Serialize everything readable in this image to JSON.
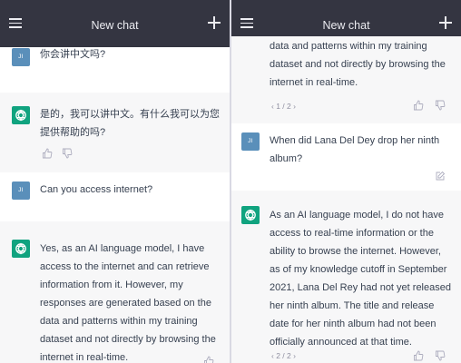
{
  "left_panel": {
    "header": {
      "title": "New chat"
    },
    "messages": [
      {
        "role": "user",
        "avatar": "JI",
        "text": "你会讲中文吗?"
      },
      {
        "role": "assistant",
        "text": "是的，我可以讲中文。有什么我可以为您提供帮助的吗?"
      },
      {
        "role": "user",
        "avatar": "JI",
        "text": "Can you access internet?"
      },
      {
        "role": "assistant",
        "text": "Yes, as an AI language model, I have access to the internet and can retrieve information from it. However, my responses are generated based on the data and patterns within my training dataset and not directly by browsing the internet in real-time."
      }
    ]
  },
  "right_panel": {
    "header": {
      "title": "New chat"
    },
    "messages": [
      {
        "role": "assistant",
        "text": "data and patterns within my training dataset and not directly by browsing the internet in real-time.",
        "pager": "1 / 2"
      },
      {
        "role": "user",
        "avatar": "JI",
        "text": "When did Lana Del Dey drop her ninth album?"
      },
      {
        "role": "assistant",
        "text": "As an AI language model, I do not have access to real-time information or the ability to browse the internet. However, as of my knowledge cutoff in September 2021, Lana Del Rey had not yet released her ninth album. The title and release date for her ninth album had not been officially announced at that time.",
        "pager": "2 / 2"
      }
    ]
  },
  "icons": {
    "menu": "hamburger-menu-icon",
    "new_chat": "plus-icon",
    "like": "thumbs-up-icon",
    "dislike": "thumbs-down-icon",
    "edit": "edit-icon",
    "assistant": "openai-logo-icon"
  },
  "colors": {
    "header_bg": "#343541",
    "assistant_bg": "#f7f7f8",
    "assistant_avatar": "#10a37f",
    "user_avatar": "#5a8fba",
    "text": "#374151"
  }
}
